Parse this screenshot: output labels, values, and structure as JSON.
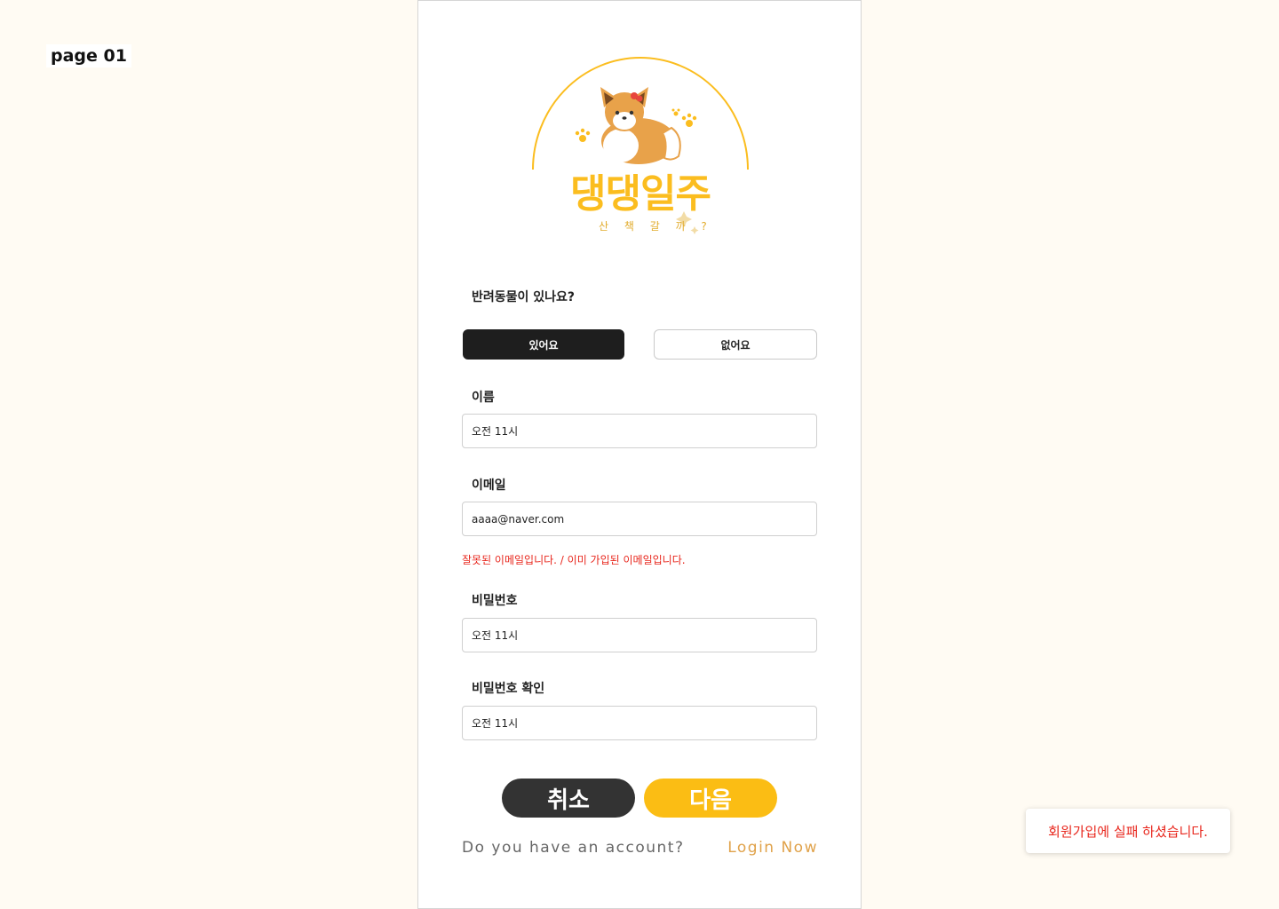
{
  "page_label": "page 01",
  "logo": {
    "title": "댕댕일주",
    "subtitle": "산 책 갈 까 ?",
    "colors": {
      "arc": "#fbbd1f",
      "dog": "#e8a24a",
      "text": "#fbbd1f"
    }
  },
  "pet_question": {
    "label": "반려동물이 있나요?",
    "options": [
      "있어요",
      "없어요"
    ],
    "selected": "있어요"
  },
  "fields": {
    "name": {
      "label": "이름",
      "value": "오전 11시"
    },
    "email": {
      "label": "이메일",
      "value": "aaaa@naver.com",
      "error": "잘못된 이메일입니다. / 이미 가입된 이메일입니다."
    },
    "password": {
      "label": "비밀번호",
      "value": "오전 11시"
    },
    "password_confirm": {
      "label": "비밀번호 확인",
      "value": "오전 11시"
    }
  },
  "buttons": {
    "cancel": "취소",
    "next": "다음"
  },
  "account": {
    "question": "Do you  have an account?",
    "login_link": "Login Now"
  },
  "toast": {
    "message": "회원가입에 실패 하셨습니다."
  },
  "colors": {
    "background": "#fffbf3",
    "accent": "#fbbd14",
    "dark": "#1e1e1e",
    "error": "#e8261c"
  }
}
